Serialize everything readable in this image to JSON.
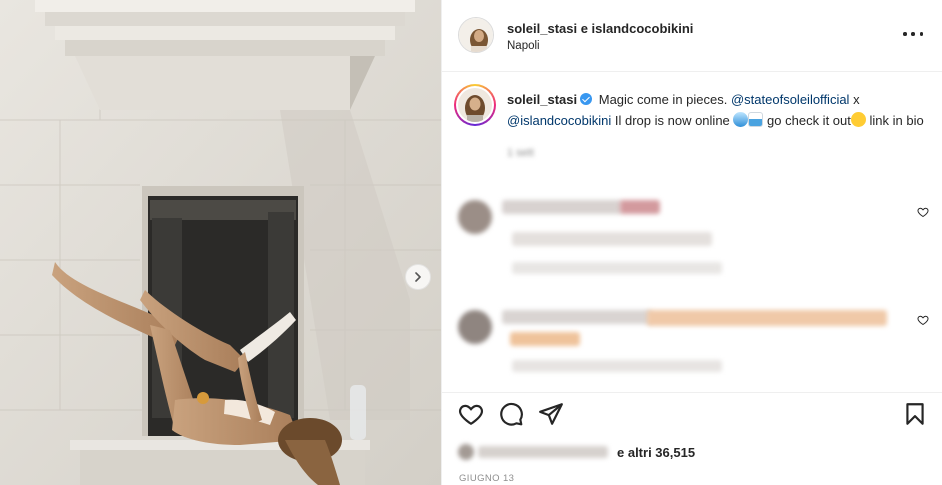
{
  "post": {
    "header": {
      "usernames": "soleil_stasi e islandcocobikini",
      "location": "Napoli"
    },
    "caption": {
      "username": "soleil_stasi",
      "text_1": "Magic come in pieces.",
      "mention_1": "@stateofsoleilofficial",
      "text_2": "x",
      "mention_2": "@islandcocobikini",
      "text_3": "Il drop is now online",
      "text_4": "go check it out",
      "text_5": "link in bio",
      "age": "1 sett"
    },
    "likes": {
      "text": "e altri 36,515"
    },
    "date": "GIUGNO 13"
  },
  "icons": {
    "more": "more-horizontal-icon",
    "carousel_next": "chevron-right-icon",
    "like": "heart-icon",
    "comment": "comment-icon",
    "share": "paper-plane-icon",
    "save": "bookmark-icon",
    "verified": "verified-badge-icon"
  },
  "colors": {
    "text": "#262626",
    "secondary": "#8e8e8e",
    "link": "#00376b",
    "verified": "#3897f0",
    "divider": "#efefef"
  }
}
